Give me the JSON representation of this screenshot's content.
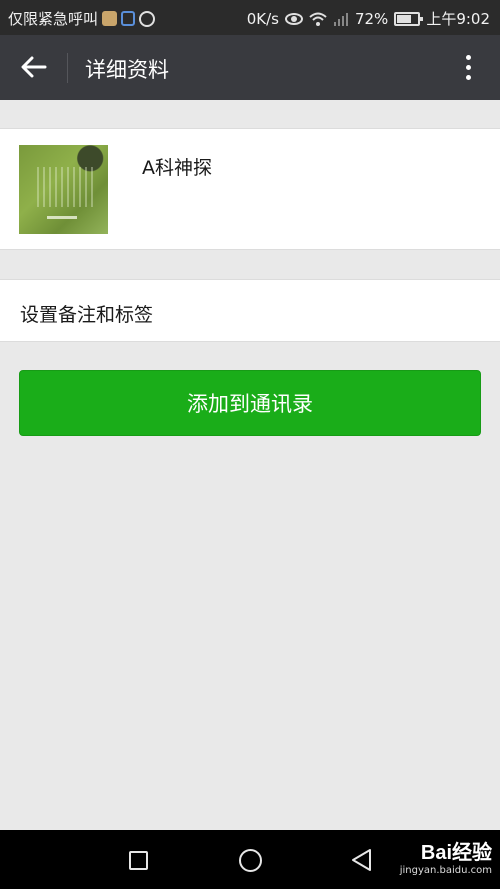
{
  "status_bar": {
    "carrier": "仅限紧急呼叫",
    "speed": "0K/s",
    "battery": "72%",
    "battery_level": 0.72,
    "time": "上午9:02"
  },
  "app_bar": {
    "title": "详细资料",
    "back_icon": "arrow-left-icon",
    "more_icon": "more-vertical-icon"
  },
  "profile": {
    "name": "A科神探"
  },
  "remark_row": {
    "label": "设置备注和标签"
  },
  "actions": {
    "add_contact_label": "添加到通讯录"
  },
  "colors": {
    "primary_green": "#1aad19",
    "app_bar": "#393a3f",
    "background": "#e9e9e9"
  },
  "watermark": {
    "logo": "Bai经验",
    "url": "jingyan.baidu.com"
  }
}
